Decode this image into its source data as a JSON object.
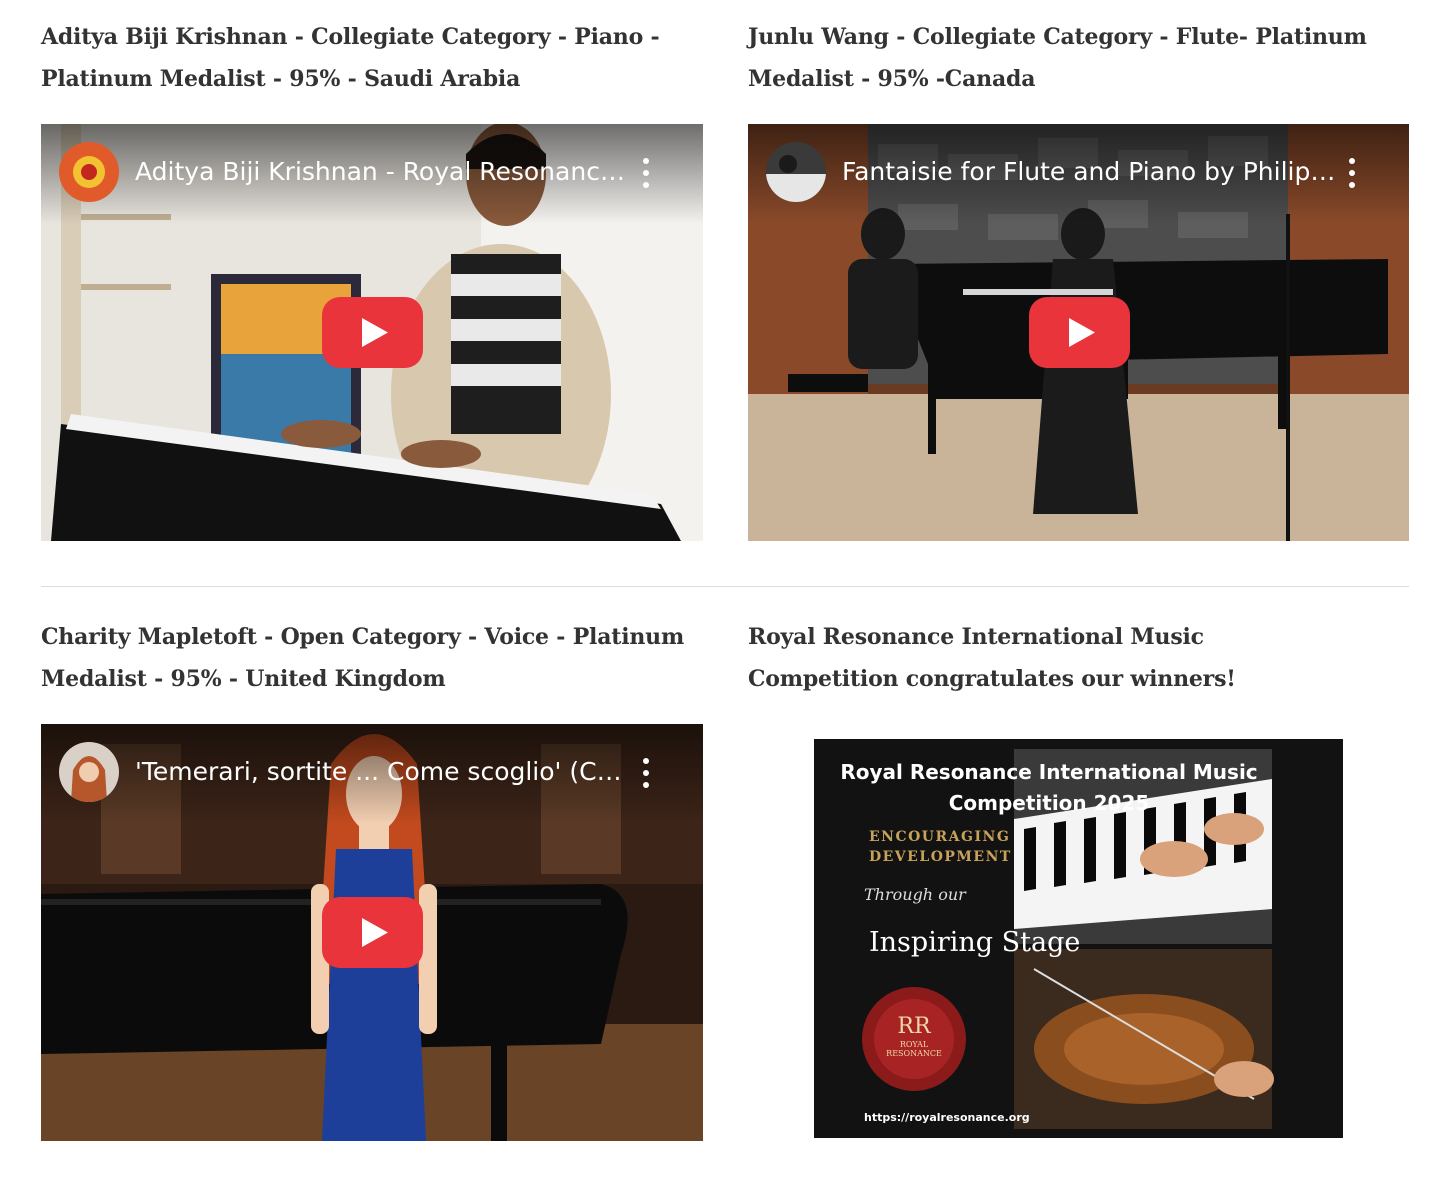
{
  "entries": [
    {
      "heading": "Aditya Biji Krishnan - Collegiate Category - Piano - Platinum Medalist - 95% - Saudi Arabia",
      "video_title": "Aditya Biji Krishnan - Royal Resonance International Music Competition",
      "play_icon": "youtube-play-icon",
      "menu_icon": "more-vert-icon"
    },
    {
      "heading": "Junlu Wang - Collegiate Category - Flute- Platinum Medalist - 95% -Canada",
      "video_title": "Fantaisie for Flute and Piano by Philippe Gaubert",
      "play_icon": "youtube-play-icon",
      "menu_icon": "more-vert-icon"
    },
    {
      "heading": "Charity Mapletoft - Open Category - Voice - Platinum Medalist - 95% - United Kingdom",
      "video_title": "'Temerari, sortite ... Come scoglio' (Così fan tutte)",
      "play_icon": "youtube-play-icon",
      "menu_icon": "more-vert-icon"
    }
  ],
  "closing": {
    "heading": "Royal Resonance International Music Competition congratulates our winners!",
    "poster": {
      "title": "Royal Resonance International Music Competition 2025",
      "tagline": "ENCOURAGING DEVELOPMENT",
      "script": "Through our",
      "stage": "Inspiring Stage",
      "seal_monogram": "RR",
      "seal_text": "ROYAL RESONANCE",
      "url": "https://royalresonance.org"
    }
  },
  "colors": {
    "text": "#333333",
    "divider": "#dddddd",
    "youtube_red": "#ff0000",
    "seal_red": "#8b1a1a",
    "gold": "#c9a25a"
  }
}
